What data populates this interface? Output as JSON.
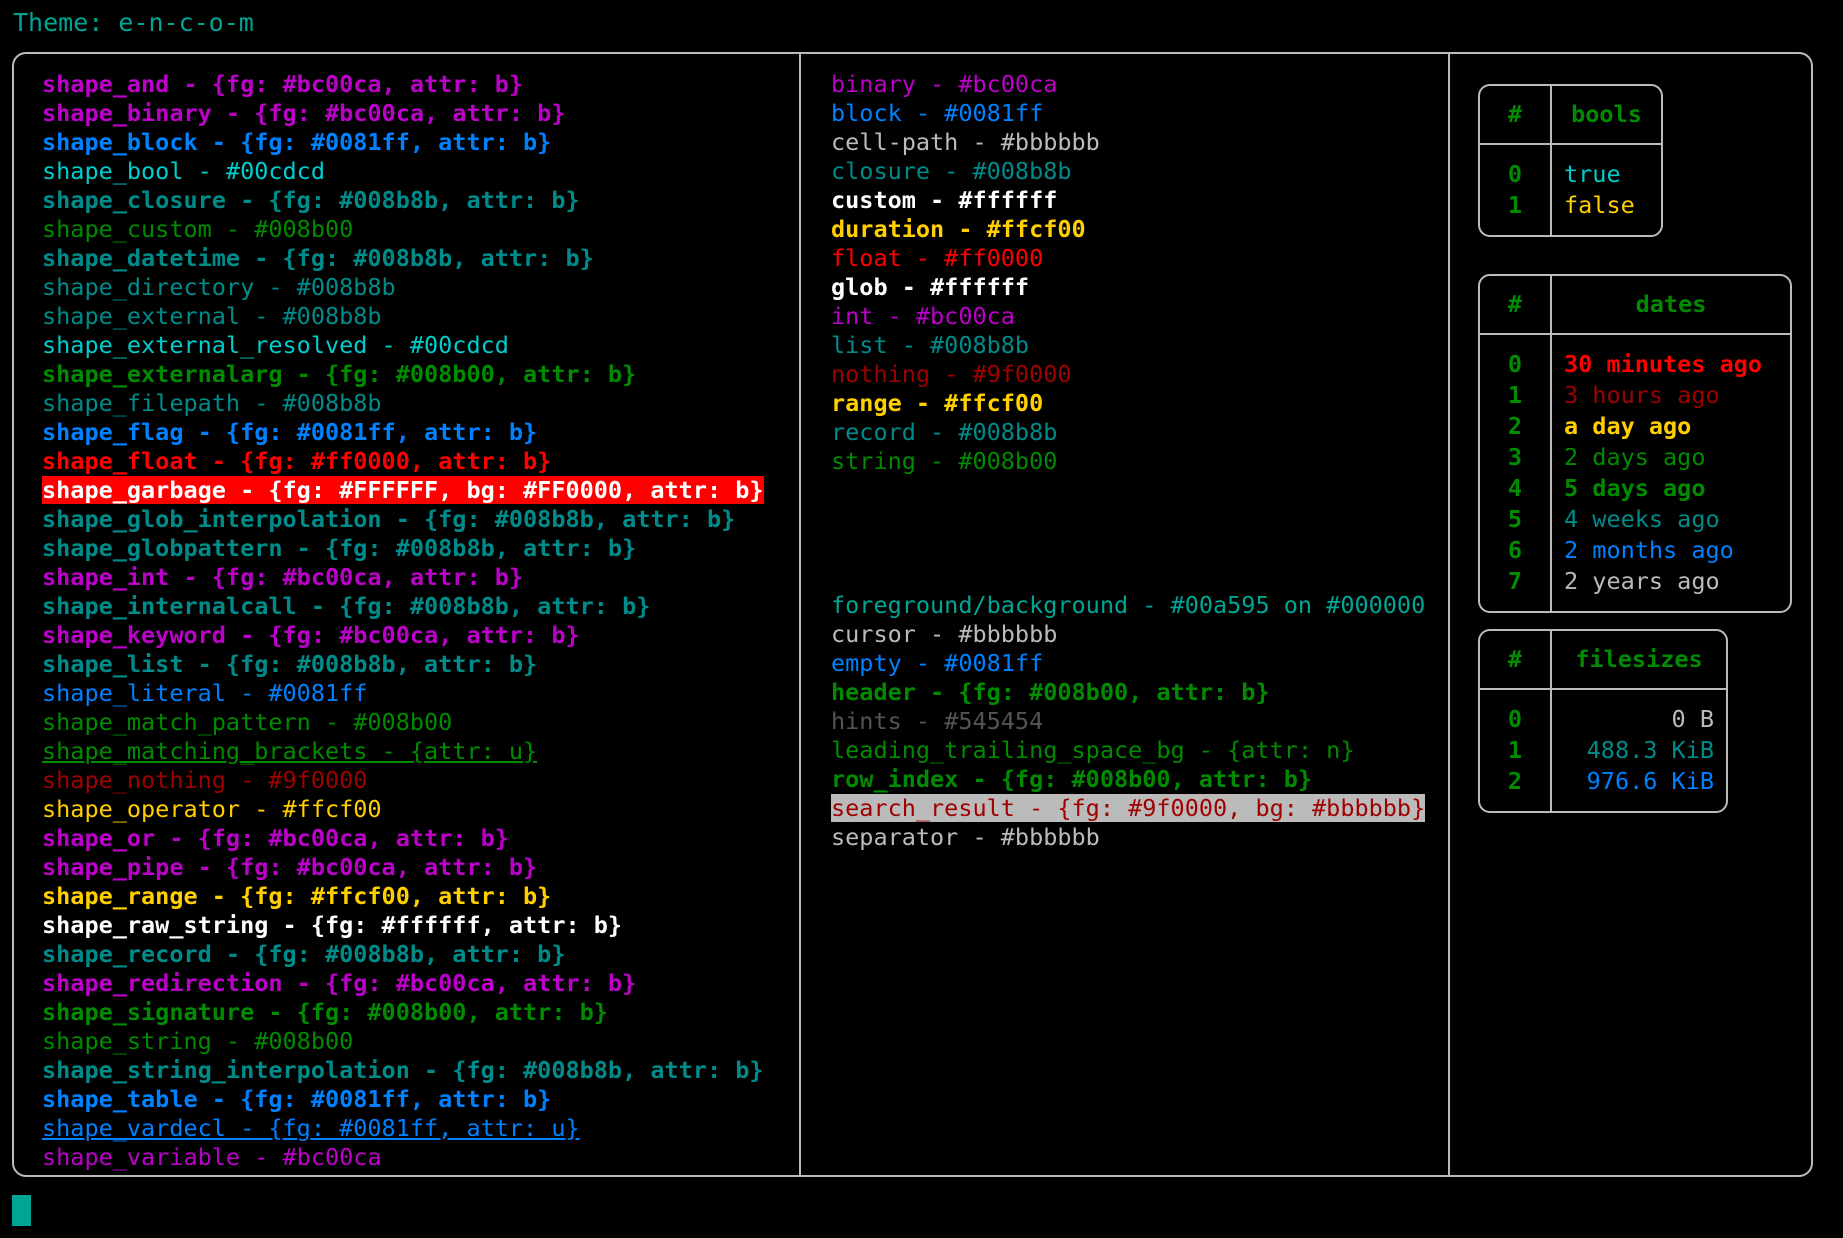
{
  "header": {
    "label": "Theme: e-n-c-o-m"
  },
  "shapes": [
    {
      "text": "shape_and - {fg: #bc00ca, attr: b}",
      "color": "#bc00ca",
      "bold": true
    },
    {
      "text": "shape_binary - {fg: #bc00ca, attr: b}",
      "color": "#bc00ca",
      "bold": true
    },
    {
      "text": "shape_block - {fg: #0081ff, attr: b}",
      "color": "#0081ff",
      "bold": true
    },
    {
      "text": "shape_bool - #00cdcd",
      "color": "#00cdcd",
      "bold": false
    },
    {
      "text": "shape_closure - {fg: #008b8b, attr: b}",
      "color": "#008b8b",
      "bold": true
    },
    {
      "text": "shape_custom - #008b00",
      "color": "#008b00",
      "bold": false
    },
    {
      "text": "shape_datetime - {fg: #008b8b, attr: b}",
      "color": "#008b8b",
      "bold": true
    },
    {
      "text": "shape_directory - #008b8b",
      "color": "#008b8b",
      "bold": false
    },
    {
      "text": "shape_external - #008b8b",
      "color": "#008b8b",
      "bold": false
    },
    {
      "text": "shape_external_resolved - #00cdcd",
      "color": "#00cdcd",
      "bold": false
    },
    {
      "text": "shape_externalarg - {fg: #008b00, attr: b}",
      "color": "#008b00",
      "bold": true
    },
    {
      "text": "shape_filepath - #008b8b",
      "color": "#008b8b",
      "bold": false
    },
    {
      "text": "shape_flag - {fg: #0081ff, attr: b}",
      "color": "#0081ff",
      "bold": true
    },
    {
      "text": "shape_float - {fg: #ff0000, attr: b}",
      "color": "#ff0000",
      "bold": true
    },
    {
      "text": "shape_garbage - {fg: #FFFFFF, bg: #FF0000, attr: b}",
      "color": "#ffffff",
      "bg": "#ff0000",
      "bold": true
    },
    {
      "text": "shape_glob_interpolation - {fg: #008b8b, attr: b}",
      "color": "#008b8b",
      "bold": true
    },
    {
      "text": "shape_globpattern - {fg: #008b8b, attr: b}",
      "color": "#008b8b",
      "bold": true
    },
    {
      "text": "shape_int - {fg: #bc00ca, attr: b}",
      "color": "#bc00ca",
      "bold": true
    },
    {
      "text": "shape_internalcall - {fg: #008b8b, attr: b}",
      "color": "#008b8b",
      "bold": true
    },
    {
      "text": "shape_keyword - {fg: #bc00ca, attr: b}",
      "color": "#bc00ca",
      "bold": true
    },
    {
      "text": "shape_list - {fg: #008b8b, attr: b}",
      "color": "#008b8b",
      "bold": true
    },
    {
      "text": "shape_literal - #0081ff",
      "color": "#0081ff",
      "bold": false
    },
    {
      "text": "shape_match_pattern - #008b00",
      "color": "#008b00",
      "bold": false
    },
    {
      "text": "shape_matching_brackets - {attr: u}",
      "color": "#008b00",
      "bold": false,
      "underline": true
    },
    {
      "text": "shape_nothing - #9f0000",
      "color": "#9f0000",
      "bold": false
    },
    {
      "text": "shape_operator - #ffcf00",
      "color": "#ffcf00",
      "bold": false
    },
    {
      "text": "shape_or - {fg: #bc00ca, attr: b}",
      "color": "#bc00ca",
      "bold": true
    },
    {
      "text": "shape_pipe - {fg: #bc00ca, attr: b}",
      "color": "#bc00ca",
      "bold": true
    },
    {
      "text": "shape_range - {fg: #ffcf00, attr: b}",
      "color": "#ffcf00",
      "bold": true
    },
    {
      "text": "shape_raw_string - {fg: #ffffff, attr: b}",
      "color": "#ffffff",
      "bold": true
    },
    {
      "text": "shape_record - {fg: #008b8b, attr: b}",
      "color": "#008b8b",
      "bold": true
    },
    {
      "text": "shape_redirection - {fg: #bc00ca, attr: b}",
      "color": "#bc00ca",
      "bold": true
    },
    {
      "text": "shape_signature - {fg: #008b00, attr: b}",
      "color": "#008b00",
      "bold": true
    },
    {
      "text": "shape_string - #008b00",
      "color": "#008b00",
      "bold": false
    },
    {
      "text": "shape_string_interpolation - {fg: #008b8b, attr: b}",
      "color": "#008b8b",
      "bold": true
    },
    {
      "text": "shape_table - {fg: #0081ff, attr: b}",
      "color": "#0081ff",
      "bold": true
    },
    {
      "text": "shape_vardecl - {fg: #0081ff, attr: u}",
      "color": "#0081ff",
      "bold": false,
      "underline": true
    },
    {
      "text": "shape_variable - #bc00ca",
      "color": "#bc00ca",
      "bold": false
    }
  ],
  "types": [
    {
      "text": "binary - #bc00ca",
      "color": "#bc00ca",
      "bold": false
    },
    {
      "text": "block - #0081ff",
      "color": "#0081ff",
      "bold": false
    },
    {
      "text": "cell-path - #bbbbbb",
      "color": "#bbbbbb",
      "bold": false
    },
    {
      "text": "closure - #008b8b",
      "color": "#008b8b",
      "bold": false
    },
    {
      "text": "custom - #ffffff",
      "color": "#ffffff",
      "bold": true
    },
    {
      "text": "duration - #ffcf00",
      "color": "#ffcf00",
      "bold": true
    },
    {
      "text": "float - #ff0000",
      "color": "#ff0000",
      "bold": false
    },
    {
      "text": "glob - #ffffff",
      "color": "#ffffff",
      "bold": true
    },
    {
      "text": "int - #bc00ca",
      "color": "#bc00ca",
      "bold": false
    },
    {
      "text": "list - #008b8b",
      "color": "#008b8b",
      "bold": false
    },
    {
      "text": "nothing - #9f0000",
      "color": "#9f0000",
      "bold": false
    },
    {
      "text": "range - #ffcf00",
      "color": "#ffcf00",
      "bold": true
    },
    {
      "text": "record - #008b8b",
      "color": "#008b8b",
      "bold": false
    },
    {
      "text": "string - #008b00",
      "color": "#008b00",
      "bold": false
    }
  ],
  "ui_elements": [
    {
      "text": "foreground/background - #00a595 on #000000",
      "color": "#00a595",
      "bold": false
    },
    {
      "text": "cursor - #bbbbbb",
      "color": "#bbbbbb",
      "bold": false
    },
    {
      "text": "empty - #0081ff",
      "color": "#0081ff",
      "bold": false
    },
    {
      "text": "header - {fg: #008b00, attr: b}",
      "color": "#008b00",
      "bold": true
    },
    {
      "text": "hints - #545454",
      "color": "#545454",
      "bold": false
    },
    {
      "text": "leading_trailing_space_bg - {attr: n}",
      "color": "#008b00",
      "bold": false
    },
    {
      "text": "row_index - {fg: #008b00, attr: b}",
      "color": "#008b00",
      "bold": true
    },
    {
      "text": "search_result - {fg: #9f0000, bg: #bbbbbb}",
      "color": "#9f0000",
      "bg": "#bbbbbb",
      "bold": false
    },
    {
      "text": "separator - #bbbbbb",
      "color": "#bbbbbb",
      "bold": false
    }
  ],
  "tables": {
    "bools": {
      "headers": [
        "#",
        "bools"
      ],
      "rows": [
        {
          "index": "0",
          "value": "true",
          "color": "#00cdcd",
          "bold": false
        },
        {
          "index": "1",
          "value": "false",
          "color": "#ffcf00",
          "bold": false
        }
      ]
    },
    "dates": {
      "headers": [
        "#",
        "dates"
      ],
      "rows": [
        {
          "index": "0",
          "value": "30 minutes ago",
          "color": "#ff0000",
          "bold": true
        },
        {
          "index": "1",
          "value": "3 hours ago",
          "color": "#9f0000",
          "bold": false
        },
        {
          "index": "2",
          "value": "a day ago",
          "color": "#ffcf00",
          "bold": true
        },
        {
          "index": "3",
          "value": "2 days ago",
          "color": "#008b00",
          "bold": false
        },
        {
          "index": "4",
          "value": "5 days ago",
          "color": "#008b00",
          "bold": true
        },
        {
          "index": "5",
          "value": "4 weeks ago",
          "color": "#008b8b",
          "bold": false
        },
        {
          "index": "6",
          "value": "2 months ago",
          "color": "#0081ff",
          "bold": false
        },
        {
          "index": "7",
          "value": "2 years ago",
          "color": "#bbbbbb",
          "bold": false
        }
      ]
    },
    "filesizes": {
      "headers": [
        "#",
        "filesizes"
      ],
      "rows": [
        {
          "index": "0",
          "value": "0 B",
          "color": "#bbbbbb",
          "bold": false
        },
        {
          "index": "1",
          "value": "488.3 KiB",
          "color": "#008b8b",
          "bold": false
        },
        {
          "index": "2",
          "value": "976.6 KiB",
          "color": "#0081ff",
          "bold": false
        }
      ]
    }
  },
  "cursor": {
    "color": "#00a595"
  },
  "palette": {
    "border": "#bbbbbb",
    "background": "#000000",
    "accent": "#00a595"
  }
}
